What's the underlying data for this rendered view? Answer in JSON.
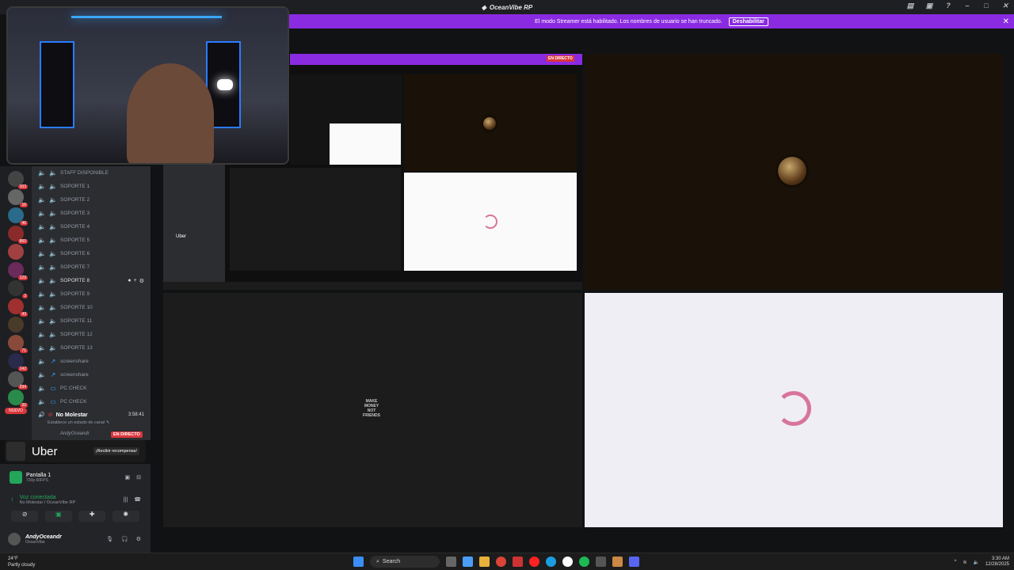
{
  "titlebar": {
    "title": "OceanVibe RP"
  },
  "banner": {
    "message": "El modo Streamer está habilitado. Los nombres de usuario se han truncado.",
    "button": "Deshabilitar"
  },
  "servers": [
    {
      "count": "103"
    },
    {
      "count": "16"
    },
    {
      "count": "46"
    },
    {
      "count": "860"
    },
    {
      "count": ""
    },
    {
      "count": "129"
    },
    {
      "count": "3"
    },
    {
      "count": "43"
    },
    {
      "count": ""
    },
    {
      "count": "71"
    },
    {
      "count": "142"
    },
    {
      "count": "294"
    },
    {
      "count": "20"
    }
  ],
  "servers_new_label": "NUEVO",
  "channels": [
    {
      "label": "STAFF DISPONIBLE"
    },
    {
      "label": "SOPORTE 1"
    },
    {
      "label": "SOPORTE 2"
    },
    {
      "label": "SOPORTE 3"
    },
    {
      "label": "SOPORTE 4"
    },
    {
      "label": "SOPORTE 5"
    },
    {
      "label": "SOPORTE 6"
    },
    {
      "label": "SOPORTE 7"
    },
    {
      "label": "SOPORTE 8"
    },
    {
      "label": "SOPORTE 9"
    },
    {
      "label": "SOPORTE 10"
    },
    {
      "label": "SOPORTE 11"
    },
    {
      "label": "SOPORTE 12"
    },
    {
      "label": "SOPORTE 13"
    },
    {
      "label": "screenshare"
    },
    {
      "label": "screenshare"
    },
    {
      "label": "PC CHECK"
    },
    {
      "label": "PC CHECK"
    }
  ],
  "voice": {
    "channel_name": "No Molestar",
    "timer": "3:58:41",
    "status_prompt": "Establece un estado de canal",
    "user": "AndyOceandr",
    "live_badge": "EN DIRECTO"
  },
  "ad": {
    "brand": "Uber",
    "cta": "¡Recibir recompensa!"
  },
  "screen_share": {
    "title": "Pantalla 1",
    "quality": "720p 60FPS"
  },
  "connection": {
    "status": "Voz conectada",
    "location": "No Molestar / OceanVibe RP"
  },
  "user_panel": {
    "name": "AndyOceandr",
    "server": "OceanVibe"
  },
  "stream": {
    "nested_live_badge": "EN DIRECTO",
    "nested_uber": "Uber",
    "tile_text": "MAKE MONEY NOT FRIENDS"
  },
  "taskbar": {
    "search_placeholder": "Search",
    "time": "3:30 AM",
    "date": "12/28/2025"
  },
  "weather": {
    "temp": "24°F",
    "condition": "Partly cloudy"
  },
  "colors": {
    "accent": "#8a2be2",
    "live": "#da373c",
    "brand": "#5865f2"
  }
}
